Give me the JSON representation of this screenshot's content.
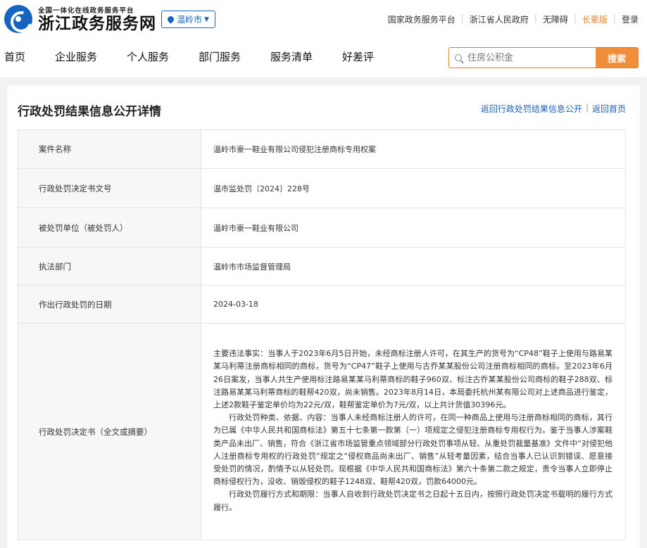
{
  "header": {
    "logo_subtitle": "全国一体化在线政务服务平台",
    "logo_title": "浙江政务服务网",
    "region": "温岭市",
    "top_links": [
      "国家政务服务平台",
      "浙江省人民政府",
      "无障碍",
      "长辈版",
      "登录"
    ]
  },
  "nav": {
    "items": [
      "首页",
      "企业服务",
      "个人服务",
      "部门服务",
      "服务清单",
      "好差评"
    ]
  },
  "search": {
    "placeholder": "住房公积金",
    "button": "搜索"
  },
  "page": {
    "title": "行政处罚结果信息公开详情",
    "back_list": "返回行政处罚结果信息公开",
    "back_home": "返回首页"
  },
  "details": {
    "rows": [
      {
        "label": "案件名称",
        "value": "温岭市豪一鞋业有限公司侵犯注册商标专用权案"
      },
      {
        "label": "行政处罚决定书文号",
        "value": "温市监处罚〔2024〕228号"
      },
      {
        "label": "被处罚单位（被处罚人）",
        "value": "温岭市豪一鞋业有限公司"
      },
      {
        "label": "执法部门",
        "value": "温岭市市场监督管理局"
      },
      {
        "label": "作出行政处罚的日期",
        "value": "2024-03-18"
      }
    ],
    "decision": {
      "label": "行政处罚决定书（全文或摘要）",
      "paragraphs": [
        "主要违法事实：当事人于2023年6月5日开始，未经商标注册人许可，在其生产的货号为“CP48”鞋子上使用与路易某某马利蒂注册商标相同的商标，货号为“CP47”鞋子上使用与古乔某某股份公司注册商标相同的商标。至2023年6月26日案发，当事人共生产使用标注路易某某马利蒂商标的鞋子960双、标注古乔某某股份公司商标的鞋子288双、标注路易某某马利蒂商标的鞋帮420双，尚未销售。2023年8月14日，本局委托杭州某有限公司对上述商品进行鉴定，上述2款鞋子鉴定单价均为22元/双，鞋帮鉴定单价为7元/双，以上共计货值30396元。",
        "行政处罚种类、依据、内容：当事人未经商标注册人的许可，在同一种商品上使用与注册商标相同的商标，其行为已属《中华人民共和国商标法》第五十七条第一款第（一）项规定之侵犯注册商标专用权行为。鉴于当事人涉案鞋类产品未出厂、销售，符合《浙江省市场监管重点领域部分行政处罚事项从轻、从重处罚裁量基准》文件中“对侵犯他人注册商标专用权的行政处罚”规定之“侵权商品尚未出厂、销售”从轻考量因素，结合当事人已认识到错误、愿意接受处罚的情况，酌情予以从轻处罚。现根据《中华人民共和国商标法》第六十条第二款之规定，责令当事人立即停止商标侵权行为，没收、销毁侵权的鞋子1248双、鞋帮420双，罚款64000元。",
        "行政处罚履行方式和期限：当事人自收到行政处罚决定书之日起十五日内，按照行政处罚决定书载明的履行方式履行。"
      ]
    }
  },
  "colors": {
    "brand_blue": "#1565c0",
    "accent_orange": "#f08e3a",
    "link_blue": "#1a5fb4"
  }
}
